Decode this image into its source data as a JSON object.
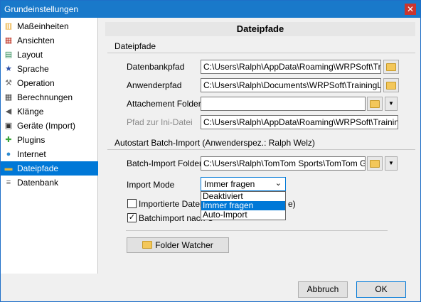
{
  "window": {
    "title": "Grundeinstellungen",
    "close_glyph": "✕"
  },
  "sidebar": {
    "items": [
      {
        "label": "Maßeinheiten",
        "icon": "ruler-icon",
        "glyph": "▥",
        "color": "#e8a21c"
      },
      {
        "label": "Ansichten",
        "icon": "calendar-icon",
        "glyph": "▦",
        "color": "#c0392b"
      },
      {
        "label": "Layout",
        "icon": "layout-icon",
        "glyph": "▤",
        "color": "#2e8b57"
      },
      {
        "label": "Sprache",
        "icon": "flag-icon",
        "glyph": "★",
        "color": "#2b4fa8"
      },
      {
        "label": "Operation",
        "icon": "wrench-icon",
        "glyph": "⚒",
        "color": "#6d6d6d"
      },
      {
        "label": "Berechnungen",
        "icon": "calculator-icon",
        "glyph": "▦",
        "color": "#444444"
      },
      {
        "label": "Klänge",
        "icon": "speaker-icon",
        "glyph": "◀",
        "color": "#555555"
      },
      {
        "label": "Geräte (Import)",
        "icon": "device-icon",
        "glyph": "▣",
        "color": "#333333"
      },
      {
        "label": "Plugins",
        "icon": "puzzle-icon",
        "glyph": "✚",
        "color": "#3aa53a"
      },
      {
        "label": "Internet",
        "icon": "globe-icon",
        "glyph": "●",
        "color": "#2e8bd1"
      },
      {
        "label": "Dateipfade",
        "icon": "folder-icon",
        "glyph": "▬",
        "color": "#e8b53a"
      },
      {
        "label": "Datenbank",
        "icon": "database-icon",
        "glyph": "≡",
        "color": "#666666"
      }
    ],
    "selected_index": 10
  },
  "main": {
    "heading": "Dateipfade",
    "section1": "Dateipfade",
    "datenbankpfad": {
      "label": "Datenbankpfad",
      "value": "C:\\Users\\Ralph\\AppData\\Roaming\\WRPSoft\\Training"
    },
    "anwenderpfad": {
      "label": "Anwenderpfad",
      "value": "C:\\Users\\Ralph\\Documents\\WRPSoft\\TrainingLab"
    },
    "attachement": {
      "label": "Attachement Folder",
      "value": ""
    },
    "ini": {
      "label": "Pfad zur Ini-Datei",
      "value": "C:\\Users\\Ralph\\AppData\\Roaming\\WRPSoft\\TrainingLab\\"
    },
    "section2": "Autostart Batch-Import  (Anwenderspez.: Ralph Welz)",
    "batch": {
      "label": "Batch-Import Folder",
      "value": "C:\\Users\\Ralph\\TomTom Sports\\TomTom GPS W"
    },
    "import_mode": {
      "label": "Import Mode",
      "selected": "Immer fragen",
      "options": [
        "Deaktiviert",
        "Immer fragen",
        "Auto-Import"
      ],
      "highlighted_index": 1
    },
    "checkbox1": {
      "label_visible": "Importierte Dateie",
      "label_tail": "e)",
      "checked": false
    },
    "checkbox2": {
      "label_visible": "Batchimport nach U",
      "checked": true
    },
    "folder_watcher": "Folder Watcher",
    "dropdown_arrow": "▼",
    "chevron": "⌄",
    "check_glyph": "✓"
  },
  "footer": {
    "cancel": "Abbruch",
    "ok": "OK"
  }
}
